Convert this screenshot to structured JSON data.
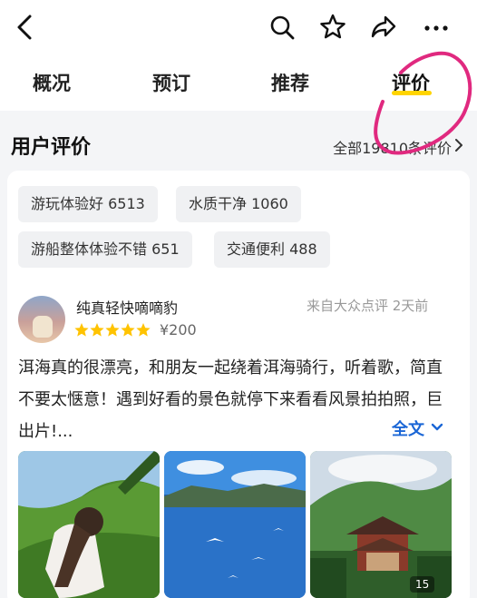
{
  "header": {
    "back_icon": "back-arrow-icon",
    "actions": [
      "search-icon",
      "star-icon",
      "share-icon",
      "more-icon"
    ]
  },
  "tabs": [
    {
      "label": "概况"
    },
    {
      "label": "预订"
    },
    {
      "label": "推荐"
    },
    {
      "label": "评价",
      "active": true
    }
  ],
  "reviews": {
    "section_title": "用户评价",
    "all_link": "全部19810条评价",
    "tags": [
      "游玩体验好 6513",
      "水质干净 1060",
      "游船整体体验不错 651",
      "交通便利 488"
    ],
    "items": [
      {
        "user": "纯真轻快嘀嘀豹",
        "rating": 5,
        "price": "¥200",
        "source": "来自大众点评 2天前",
        "text": "洱海真的很漂亮，和朋友一起绕着洱海骑行，听着歌，简直不要太惬意！遇到好看的景色就停下来看看风景拍拍照，巨出片!...",
        "full_text_label": "全文",
        "photo_count": "15"
      }
    ]
  },
  "colors": {
    "accent_yellow": "#ffd400",
    "star_yellow": "#ffc300",
    "link_blue": "#1a66d6",
    "annotation_pink": "#e0297f"
  }
}
